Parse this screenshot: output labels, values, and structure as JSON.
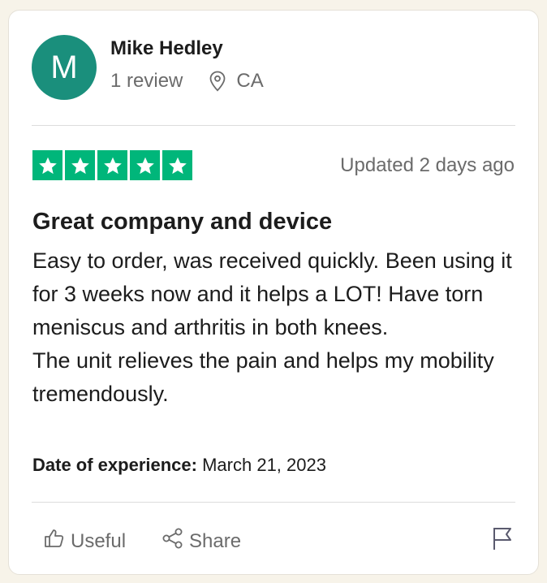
{
  "reviewer": {
    "avatar_initial": "M",
    "name": "Mike Hedley",
    "review_count": "1 review",
    "location": "CA",
    "avatar_color": "#1a8f7c"
  },
  "rating": {
    "stars": 5,
    "max_stars": 5,
    "star_color": "#00b67a",
    "updated": "Updated 2 days ago"
  },
  "review": {
    "title": "Great company and device",
    "paragraphs": [
      "Easy to order, was received quickly. Been using it for 3 weeks now and it helps a LOT! Have torn meniscus and arthritis in both knees.",
      "The unit relieves the pain and helps my mobility tremendously."
    ],
    "experience_label": "Date of experience:",
    "experience_date": "March 21, 2023"
  },
  "actions": {
    "useful_label": "Useful",
    "share_label": "Share",
    "icons": [
      "thumbs-up-icon",
      "share-icon",
      "flag-icon",
      "location-pin-icon",
      "star-icon"
    ]
  }
}
